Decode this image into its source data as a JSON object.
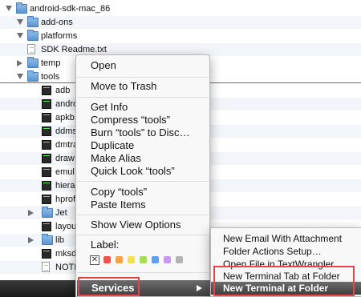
{
  "finder": {
    "rows": [
      {
        "label": "android-sdk-mac_86",
        "kind": "folder",
        "disclosure": "down",
        "level": 0
      },
      {
        "label": "add-ons",
        "kind": "folder",
        "disclosure": "down",
        "level": 1
      },
      {
        "label": "platforms",
        "kind": "folder",
        "disclosure": "down",
        "level": 1
      },
      {
        "label": "SDK Readme.txt",
        "kind": "text-file",
        "disclosure": "none",
        "level": 1
      },
      {
        "label": "temp",
        "kind": "folder",
        "disclosure": "right",
        "level": 1
      },
      {
        "label": "tools",
        "kind": "folder",
        "disclosure": "down",
        "level": 1
      },
      {
        "label": "adb",
        "kind": "executable",
        "disclosure": "none",
        "level": 2
      },
      {
        "label": "andro",
        "kind": "executable",
        "disclosure": "none",
        "level": 2
      },
      {
        "label": "apkb",
        "kind": "executable",
        "disclosure": "none",
        "level": 2
      },
      {
        "label": "ddms",
        "kind": "executable",
        "disclosure": "none",
        "level": 2
      },
      {
        "label": "dmtra",
        "kind": "executable",
        "disclosure": "none",
        "level": 2
      },
      {
        "label": "draw",
        "kind": "executable",
        "disclosure": "none",
        "level": 2
      },
      {
        "label": "emul",
        "kind": "executable",
        "disclosure": "none",
        "level": 2
      },
      {
        "label": "hiera",
        "kind": "executable",
        "disclosure": "none",
        "level": 2
      },
      {
        "label": "hprof",
        "kind": "executable",
        "disclosure": "none",
        "level": 2
      },
      {
        "label": "Jet",
        "kind": "folder",
        "disclosure": "right",
        "level": 2
      },
      {
        "label": "layou",
        "kind": "executable",
        "disclosure": "none",
        "level": 2
      },
      {
        "label": "lib",
        "kind": "folder",
        "disclosure": "right",
        "level": 2
      },
      {
        "label": "mksd",
        "kind": "executable",
        "disclosure": "none",
        "level": 2
      },
      {
        "label": "NOTI",
        "kind": "text-file",
        "disclosure": "none",
        "level": 2
      }
    ]
  },
  "context_menu": {
    "open": "Open",
    "move_to_trash": "Move to Trash",
    "get_info": "Get Info",
    "compress": "Compress “tools”",
    "burn": "Burn “tools” to Disc…",
    "duplicate": "Duplicate",
    "make_alias": "Make Alias",
    "quick_look": "Quick Look “tools”",
    "copy": "Copy “tools”",
    "paste": "Paste Items",
    "show_view_options": "Show View Options",
    "label_heading": "Label:",
    "label_none_glyph": "✕",
    "label_colors": [
      "#f0534b",
      "#f7a34a",
      "#f0e150",
      "#a8dc58",
      "#5fa0f2",
      "#c69af0",
      "#b3b3b3"
    ],
    "services": "Services"
  },
  "services_submenu": {
    "items": [
      {
        "label": "New Email With Attachment",
        "active": false
      },
      {
        "label": "Folder Actions Setup…",
        "active": false
      },
      {
        "label": "Open File in TextWrangler",
        "active": false
      },
      {
        "label": "New Terminal Tab at Folder",
        "active": false
      },
      {
        "label": "New Terminal at Folder",
        "active": true
      }
    ]
  },
  "colors": {
    "annotation_box": "#e8454a",
    "selection_accent": "#3a73cc",
    "menu_highlight": "#4f4f4f"
  }
}
